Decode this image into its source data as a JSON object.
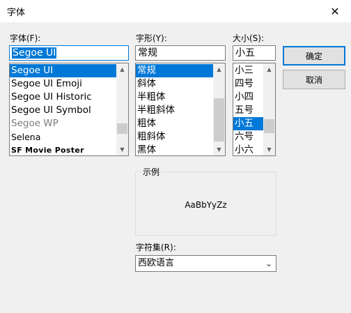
{
  "window": {
    "title": "字体",
    "close_glyph": "✕"
  },
  "font": {
    "label": "字体(F):",
    "value": "Segoe UI",
    "items": [
      "Segoe UI",
      "Segoe UI Emoji",
      "Segoe UI Historic",
      "Segoe UI Symbol",
      "Segoe WP",
      "Selena",
      "SF Movie Poster"
    ],
    "selected_index": 0
  },
  "style": {
    "label": "字形(Y):",
    "value": "常规",
    "items": [
      "常规",
      "斜体",
      "半粗体",
      "半粗斜体",
      "粗体",
      "粗斜体",
      "黑体"
    ],
    "selected_index": 0
  },
  "size": {
    "label": "大小(S):",
    "value": "小五",
    "items": [
      "小三",
      "四号",
      "小四",
      "五号",
      "小五",
      "六号",
      "小六"
    ],
    "selected_index": 4
  },
  "buttons": {
    "ok": "确定",
    "cancel": "取消"
  },
  "sample": {
    "title": "示例",
    "text": "AaBbYyZz"
  },
  "charset": {
    "label": "字符集(R):",
    "value": "西欧语言"
  },
  "icons": {
    "scroll_up": "▲",
    "scroll_down": "▼",
    "dropdown": "⌄"
  }
}
